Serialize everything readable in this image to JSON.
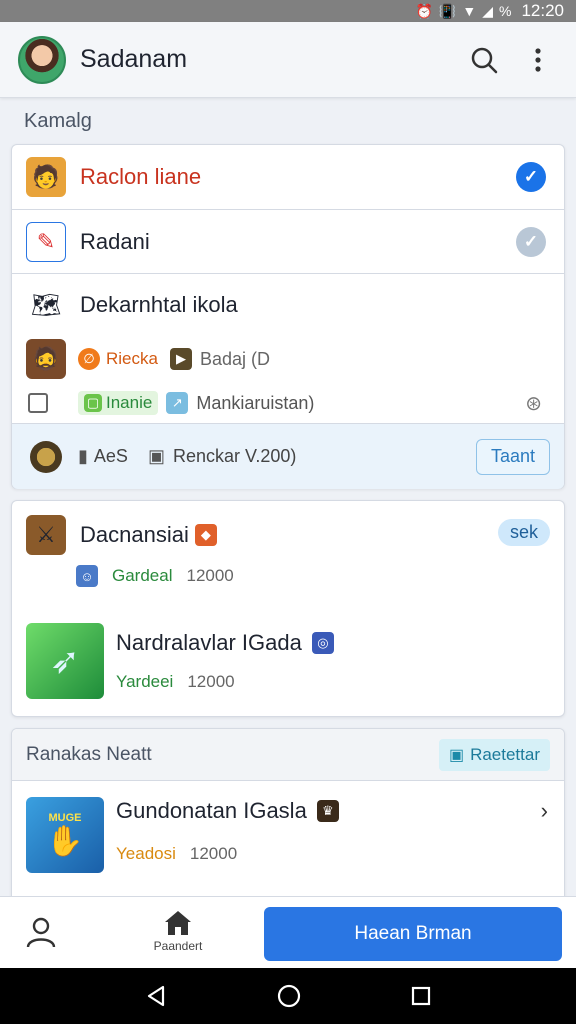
{
  "status_bar": {
    "battery": "%",
    "time": "12:20"
  },
  "app_bar": {
    "title": "Sadanam"
  },
  "section": {
    "label": "Kamalg"
  },
  "list_card": {
    "items": [
      {
        "label": "Raclon liane",
        "color": "#c8331f",
        "checked": true
      },
      {
        "label": "Radani",
        "color": "#1f2430",
        "checked": false
      }
    ],
    "group": {
      "title": "Dekarnhtal ikola",
      "line1": {
        "tag1": "Riecka",
        "tag2": "Badaj (D"
      },
      "line2": {
        "tag1": "Inanie",
        "tag2": "Mankiaruistan)"
      }
    },
    "footer": {
      "count": "AeS",
      "version": "Renckar V.200)",
      "button": "Taant"
    }
  },
  "games_card": {
    "badge": "sek",
    "games": [
      {
        "title": "Dacnansiai",
        "tag": "Gardeal",
        "value": "12000"
      },
      {
        "title": "Nardralavlar IGada",
        "tag": "Yardeei",
        "value": "12000"
      }
    ]
  },
  "recent_card": {
    "title": "Ranakas Neatt",
    "button": "Raetettar",
    "game": {
      "title": "Gundonatan IGasla",
      "tag": "Yeadosi",
      "value": "12000",
      "thumb_label": "MUGE"
    }
  },
  "bottom_nav": {
    "home_label": "Paandert",
    "primary_button": "Haean Brman"
  },
  "colors": {
    "accent": "#2a76e3",
    "check_active": "#1a73e8",
    "check_inactive": "#b9c7d6",
    "green": "#2a8a3c",
    "orange": "#d98a10"
  }
}
